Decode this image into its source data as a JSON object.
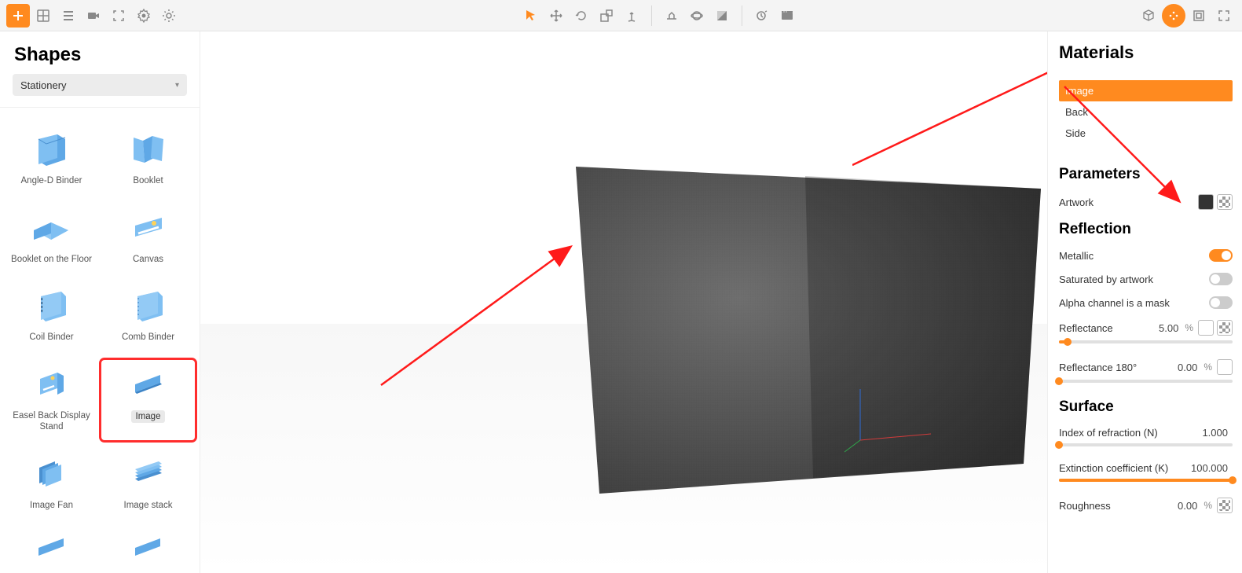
{
  "shapes": {
    "title": "Shapes",
    "category": "Stationery",
    "items": [
      {
        "id": "angle-d-binder",
        "label": "Angle-D Binder"
      },
      {
        "id": "booklet",
        "label": "Booklet"
      },
      {
        "id": "booklet-floor",
        "label": "Booklet on the Floor"
      },
      {
        "id": "canvas",
        "label": "Canvas"
      },
      {
        "id": "coil-binder",
        "label": "Coil Binder"
      },
      {
        "id": "comb-binder",
        "label": "Comb Binder"
      },
      {
        "id": "easel",
        "label": "Easel Back Display Stand"
      },
      {
        "id": "image",
        "label": "Image"
      },
      {
        "id": "image-fan",
        "label": "Image Fan"
      },
      {
        "id": "image-stack",
        "label": "Image stack"
      }
    ]
  },
  "materials": {
    "title": "Materials",
    "items": [
      "Image",
      "Back",
      "Side"
    ],
    "active": "Image"
  },
  "parameters": {
    "title": "Parameters",
    "artwork_label": "Artwork"
  },
  "reflection": {
    "title": "Reflection",
    "metallic_label": "Metallic",
    "metallic_on": true,
    "saturated_label": "Saturated by artwork",
    "saturated_on": false,
    "alpha_label": "Alpha channel is a mask",
    "alpha_on": false,
    "reflectance_label": "Reflectance",
    "reflectance_value": "5.00",
    "reflectance_pct": 5,
    "reflectance180_label": "Reflectance 180°",
    "reflectance180_value": "0.00",
    "reflectance180_pct": 0
  },
  "surface": {
    "title": "Surface",
    "ior_label": "Index of refraction (N)",
    "ior_value": "1.000",
    "ior_pct": 0,
    "ext_label": "Extinction coefficient (K)",
    "ext_value": "100.000",
    "ext_pct": 100,
    "rough_label": "Roughness",
    "rough_value": "0.00"
  },
  "unit_pct": "%"
}
